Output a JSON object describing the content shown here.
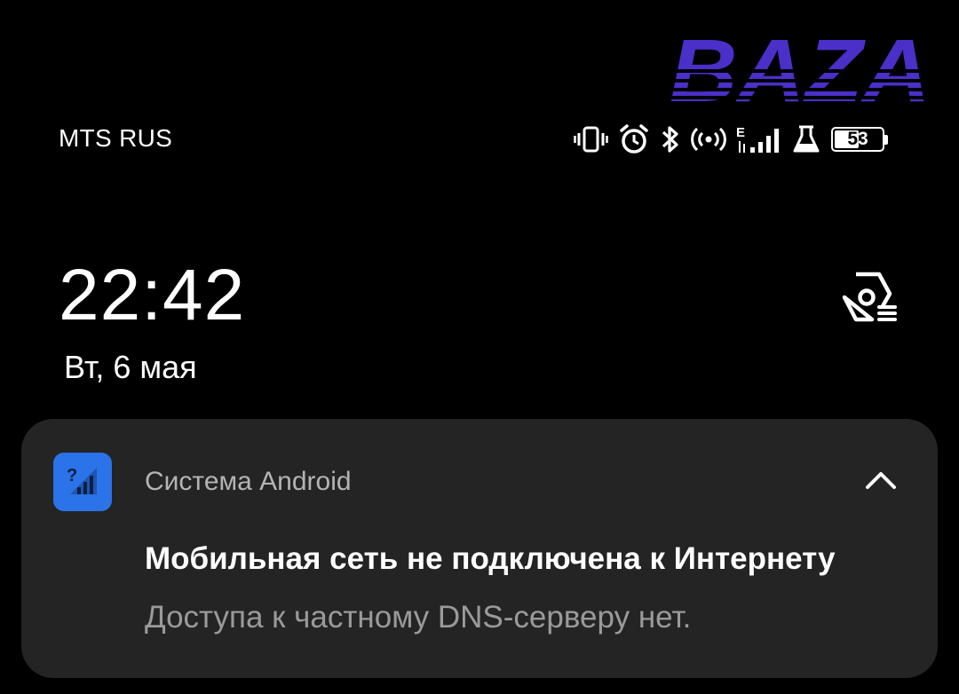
{
  "watermark": {
    "text": "BAZA",
    "color": "#4b2fc9"
  },
  "status_bar": {
    "carrier": "MTS RUS",
    "network_type": "E",
    "battery_level": "53",
    "battery_fraction": 0.53,
    "icons": [
      "vibrate-icon",
      "alarm-icon",
      "bluetooth-icon",
      "hotspot-icon",
      "signal-icon",
      "flask-icon",
      "battery-icon"
    ]
  },
  "lockscreen": {
    "time": "22:42",
    "date": "Вт, 6 мая"
  },
  "notification": {
    "app_name": "Система Android",
    "app_icon": "no-internet-signal-icon",
    "app_icon_color": "#2a73e8",
    "title": "Мобильная сеть не подключена к Интернету",
    "body": "Доступа к частному DNS-серверу нет.",
    "expanded": true
  },
  "colors": {
    "background": "#000000",
    "card": "#242424",
    "secondary_text": "#9a9a9a"
  }
}
